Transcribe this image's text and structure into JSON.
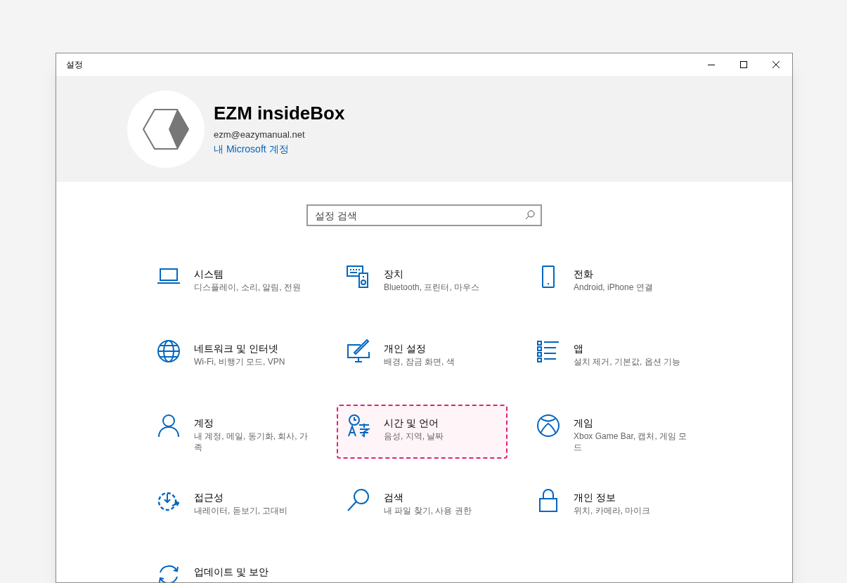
{
  "window": {
    "title": "설정"
  },
  "account": {
    "name": "EZM insideBox",
    "email": "ezm@eazymanual.net",
    "link": "내 Microsoft 계정"
  },
  "search": {
    "placeholder": "설정 검색"
  },
  "categories": [
    {
      "title": "시스템",
      "subtitle": "디스플레이, 소리, 알림, 전원",
      "selected": false
    },
    {
      "title": "장치",
      "subtitle": "Bluetooth, 프린터, 마우스",
      "selected": false
    },
    {
      "title": "전화",
      "subtitle": "Android, iPhone 연결",
      "selected": false
    },
    {
      "title": "네트워크 및 인터넷",
      "subtitle": "Wi-Fi, 비행기 모드, VPN",
      "selected": false
    },
    {
      "title": "개인 설정",
      "subtitle": "배경, 잠금 화면, 색",
      "selected": false
    },
    {
      "title": "앱",
      "subtitle": "설치 제거, 기본값, 옵션 기능",
      "selected": false
    },
    {
      "title": "계정",
      "subtitle": "내 계정, 메일, 동기화, 회사, 가족",
      "selected": false
    },
    {
      "title": "시간 및 언어",
      "subtitle": "음성, 지역, 날짜",
      "selected": true
    },
    {
      "title": "게임",
      "subtitle": "Xbox Game Bar, 캡처, 게임 모드",
      "selected": false
    },
    {
      "title": "접근성",
      "subtitle": "내레이터, 돋보기, 고대비",
      "selected": false
    },
    {
      "title": "검색",
      "subtitle": "내 파일 찾기, 사용 권한",
      "selected": false
    },
    {
      "title": "개인 정보",
      "subtitle": "위치, 카메라, 마이크",
      "selected": false
    },
    {
      "title": "업데이트 및 보안",
      "selected": false
    }
  ]
}
